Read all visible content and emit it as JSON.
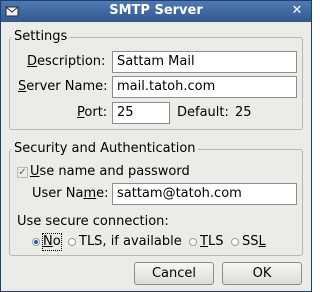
{
  "window": {
    "title": "SMTP Server"
  },
  "settings": {
    "group_label": "Settings",
    "description_label": "Description:",
    "description_value": "Sattam Mail",
    "server_name_label": "Server Name:",
    "server_name_value": "mail.tatoh.com",
    "port_label": "Port:",
    "port_value": "25",
    "default_label": "Default:",
    "default_value": "25"
  },
  "security": {
    "group_label": "Security and Authentication",
    "use_name_password_label": "Use name and password",
    "use_name_password_checked": true,
    "user_name_label": "User Name:",
    "user_name_value": "sattam@tatoh.com",
    "secure_connection_label": "Use secure connection:",
    "options": [
      {
        "label": "No",
        "selected": true
      },
      {
        "label": "TLS, if available",
        "selected": false
      },
      {
        "label": "TLS",
        "selected": false
      },
      {
        "label": "SSL",
        "selected": false
      }
    ]
  },
  "buttons": {
    "cancel_label": "Cancel",
    "ok_label": "OK"
  }
}
